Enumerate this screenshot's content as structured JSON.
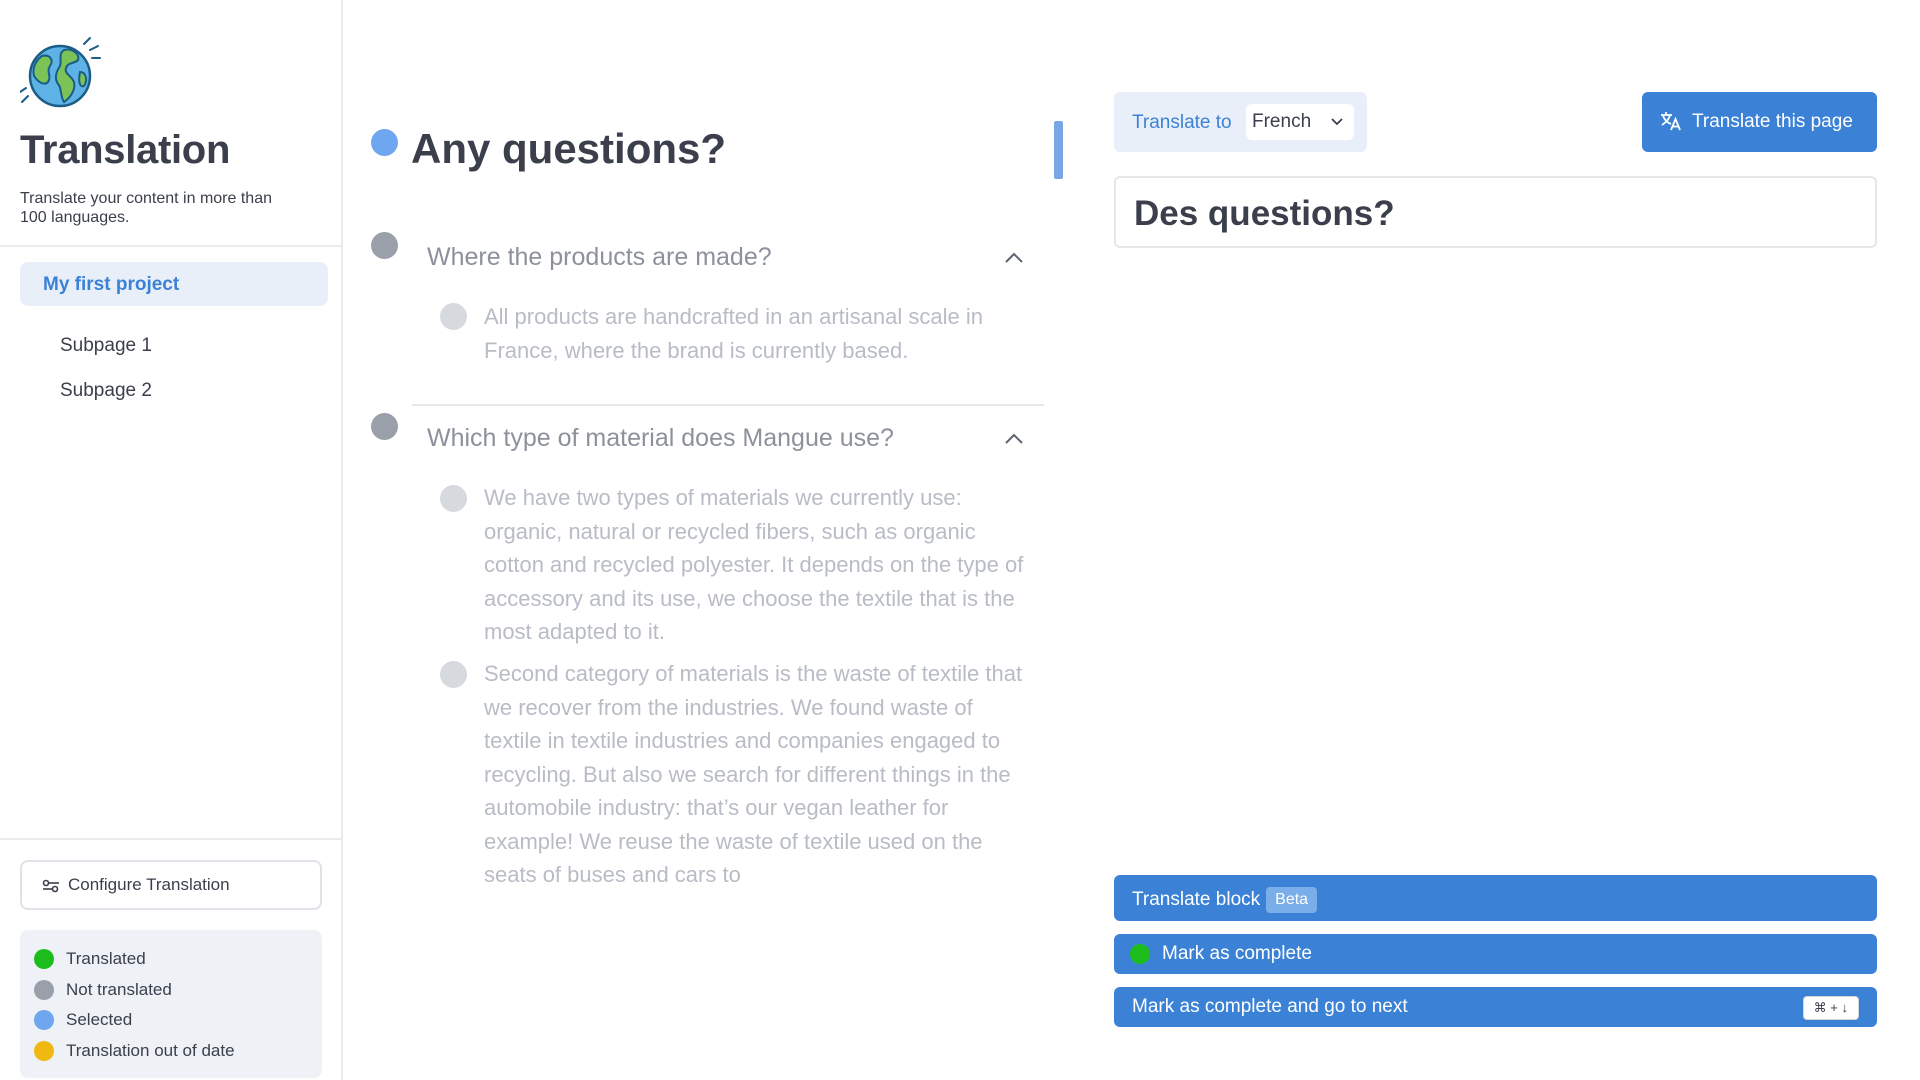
{
  "sidebar": {
    "title": "Translation",
    "subtitle": "Translate your content in more than 100 languages.",
    "project": "My first project",
    "subpages": [
      "Subpage 1",
      "Subpage 2"
    ],
    "config_label": "Configure Translation",
    "legend": [
      {
        "label": "Translated",
        "color": "#1ebd1e"
      },
      {
        "label": "Not translated",
        "color": "#9aa0aa"
      },
      {
        "label": "Selected",
        "color": "#6fa6f0"
      },
      {
        "label": "Translation out of date",
        "color": "#f0b912"
      }
    ]
  },
  "source": {
    "heading": "Any questions?",
    "questions": [
      {
        "question": "Where the products are made?",
        "answers": [
          "All products are handcrafted in an artisanal scale in France, where the brand is currently based."
        ]
      },
      {
        "question": "Which type of material does Mangue use?",
        "answers": [
          "We have two types of materials we currently use: organic, natural or recycled fibers, such as organic cotton and recycled polyester. It depends on the type of accessory and its use, we choose the textile that is the most adapted to it.",
          "Second category of materials is the waste of textile that we recover from the industries. We found waste of textile in textile industries and companies engaged to recycling. But also we search for different things in the automobile industry: that’s our vegan leather for example! We reuse the waste of textile used on the seats of buses and cars to"
        ]
      }
    ]
  },
  "target": {
    "translate_to_label": "Translate to",
    "language": "French",
    "translate_page_label": "Translate this page",
    "translated_text": "Des questions?"
  },
  "actions": {
    "translate_block": "Translate block",
    "beta": "Beta",
    "mark_complete": "Mark as complete",
    "mark_complete_next": "Mark as complete and go to next",
    "shortcut": "⌘ + ↓"
  },
  "colors": {
    "accent": "#3b82d6",
    "selected_dot": "#6fa6f0",
    "untranslated_dot": "#9aa0aa",
    "translated_dot": "#1ebd1e"
  }
}
